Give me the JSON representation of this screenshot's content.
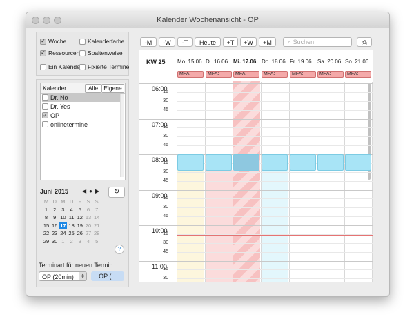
{
  "window": {
    "title": "Kalender Wochenansicht - OP"
  },
  "options": {
    "woche": "Woche",
    "kalenderfarbe": "Kalenderfarbe",
    "ressourcen": "Ressourcen",
    "spaltenweise": "Spaltenweise",
    "ein_kalender": "Ein Kalender",
    "fixierte_termine": "Fixierte Termine"
  },
  "calendars": {
    "header": "Kalender",
    "alle": "Alle",
    "eigene": "Eigene",
    "items": [
      {
        "label": "Dr. No",
        "checked": false
      },
      {
        "label": "Dr. Yes",
        "checked": false
      },
      {
        "label": "OP",
        "checked": true
      },
      {
        "label": "onlinetermine",
        "checked": false
      }
    ]
  },
  "minical": {
    "month": "Juni 2015",
    "weekdays": [
      "M",
      "D",
      "M",
      "D",
      "F",
      "S",
      "S"
    ],
    "weeks": [
      [
        "1",
        "2",
        "3",
        "4",
        "5",
        "6",
        "7"
      ],
      [
        "8",
        "9",
        "10",
        "11",
        "12",
        "13",
        "14"
      ],
      [
        "15",
        "16",
        "17",
        "18",
        "19",
        "20",
        "21"
      ],
      [
        "22",
        "23",
        "24",
        "25",
        "26",
        "27",
        "28"
      ],
      [
        "29",
        "30",
        "1",
        "2",
        "3",
        "4",
        "5"
      ]
    ],
    "today": "17"
  },
  "new_appt": {
    "label": "Terminart für neuen Termin",
    "type": "OP (20min)",
    "calendar": "OP (..."
  },
  "toolbar": {
    "minus_month": "-M",
    "minus_week": "-W",
    "minus_day": "-T",
    "today": "Heute",
    "plus_day": "+T",
    "plus_week": "+W",
    "plus_month": "+M",
    "search_placeholder": "Suchen"
  },
  "week": {
    "label": "KW 25",
    "days": [
      "Mo. 15.06.",
      "Di. 16.06.",
      "Mi. 17.06.",
      "Do. 18.06.",
      "Fr. 19.06.",
      "Sa. 20.06.",
      "So. 21.06."
    ],
    "mfa": [
      "MFA:",
      "MFA:",
      "MFA:",
      "MFA:",
      "MFA:",
      "MFA:",
      "MFA:"
    ]
  },
  "timeline": {
    "hours": [
      "06:00",
      "07:00",
      "08:00",
      "09:00",
      "10:00",
      "11:00"
    ],
    "minutes": [
      "15",
      "30",
      "45"
    ]
  },
  "colors": {
    "selected_day": "#1e88e5",
    "appointment": "#a8e4f6",
    "mfa": "#f4a9a9"
  }
}
